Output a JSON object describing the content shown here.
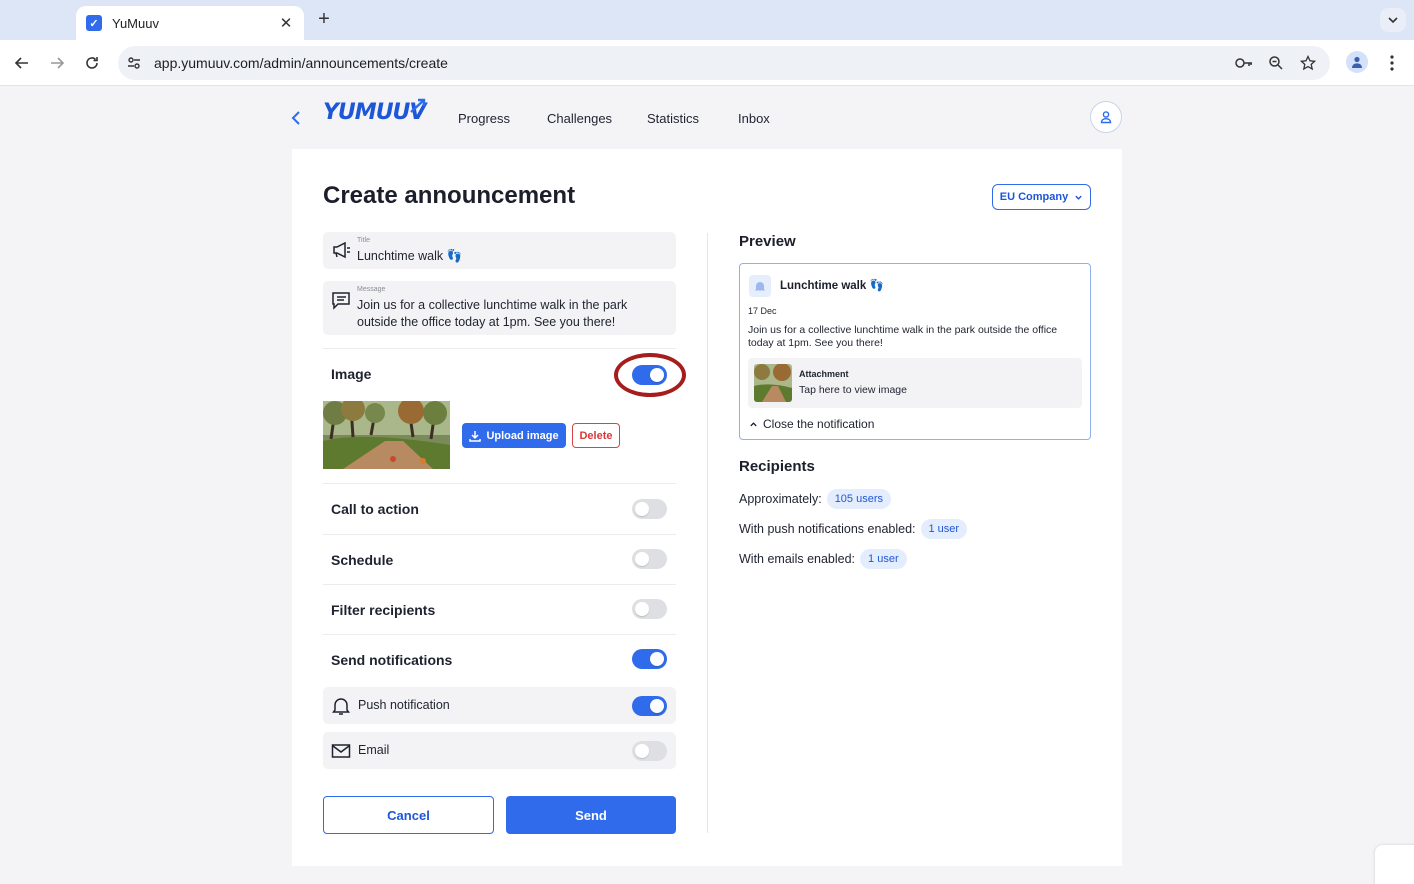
{
  "browser": {
    "tab_title": "YuMuuv",
    "tab_close": "✕",
    "new_tab": "+",
    "url": "app.yumuuv.com/admin/announcements/create"
  },
  "app": {
    "logo": "YUMUUV",
    "nav": [
      "Progress",
      "Challenges",
      "Statistics",
      "Inbox"
    ]
  },
  "form": {
    "page_title": "Create announcement",
    "company_select": "EU Company",
    "title_field": {
      "label": "Title",
      "value": "Lunchtime walk 👣"
    },
    "message_field": {
      "label": "Message",
      "value": "Join us for a collective lunchtime walk in the park outside the office today at 1pm. See you there!"
    },
    "image": {
      "label": "Image",
      "enabled": true,
      "upload_label": "Upload image",
      "delete_label": "Delete"
    },
    "call_to_action": {
      "label": "Call to action",
      "enabled": false
    },
    "schedule": {
      "label": "Schedule",
      "enabled": false
    },
    "filter_recipients": {
      "label": "Filter recipients",
      "enabled": false
    },
    "send_notifications": {
      "label": "Send notifications",
      "enabled": true
    },
    "push_notification": {
      "label": "Push notification",
      "enabled": true
    },
    "email": {
      "label": "Email",
      "enabled": false
    },
    "cancel_label": "Cancel",
    "send_label": "Send"
  },
  "preview": {
    "heading": "Preview",
    "title": "Lunchtime walk 👣",
    "date": "17 Dec",
    "message": "Join us for a collective lunchtime walk in the park outside the office today at 1pm. See you there!",
    "attachment_label": "Attachment",
    "attachment_text": "Tap here to view image",
    "close_label": "Close the notification"
  },
  "recipients": {
    "heading": "Recipients",
    "approx_label": "Approximately:",
    "approx_value": "105 users",
    "push_label": "With push notifications enabled:",
    "push_value": "1 user",
    "email_label": "With emails enabled:",
    "email_value": "1 user"
  },
  "colors": {
    "accent": "#2f6bea",
    "danger": "#d63a3a",
    "highlight_ring": "#a51d1d"
  }
}
